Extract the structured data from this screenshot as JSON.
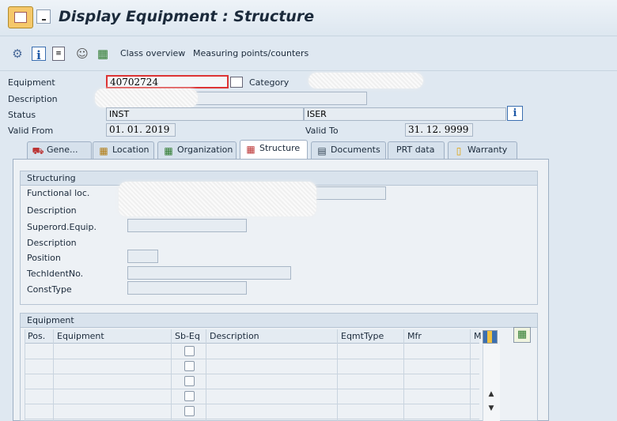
{
  "window": {
    "title": "Display Equipment : Structure"
  },
  "toolbar": {
    "class_overview": "Class overview",
    "measuring_points": "Measuring points/counters"
  },
  "header": {
    "equipment_label": "Equipment",
    "equipment_value": "40702724",
    "category_label": "Category",
    "description_label": "Description",
    "status_label": "Status",
    "status_value": "INST",
    "user_status_value": "ISER",
    "valid_from_label": "Valid From",
    "valid_from_value": "01. 01. 2019",
    "valid_to_label": "Valid To",
    "valid_to_value": "31. 12. 9999"
  },
  "tabs": [
    {
      "label": "Gene...",
      "icon": "vehicle-icon"
    },
    {
      "label": "Location",
      "icon": "location-icon"
    },
    {
      "label": "Organization",
      "icon": "org-icon"
    },
    {
      "label": "Structure",
      "icon": "structure-icon"
    },
    {
      "label": "Documents",
      "icon": "documents-icon"
    },
    {
      "label": "PRT data",
      "icon": ""
    },
    {
      "label": "Warranty",
      "icon": "warranty-icon"
    }
  ],
  "structuring": {
    "title": "Structuring",
    "functional_loc_label": "Functional loc.",
    "description_label": "Description",
    "superord_label": "Superord.Equip.",
    "description2_label": "Description",
    "position_label": "Position",
    "techident_label": "TechIdentNo.",
    "consttype_label": "ConstType"
  },
  "equipment_table": {
    "title": "Equipment",
    "columns": [
      "Pos.",
      "Equipment",
      "Sb-Eq",
      "Description",
      "EqmtType",
      "Mfr",
      "M"
    ],
    "row_count": 5
  }
}
